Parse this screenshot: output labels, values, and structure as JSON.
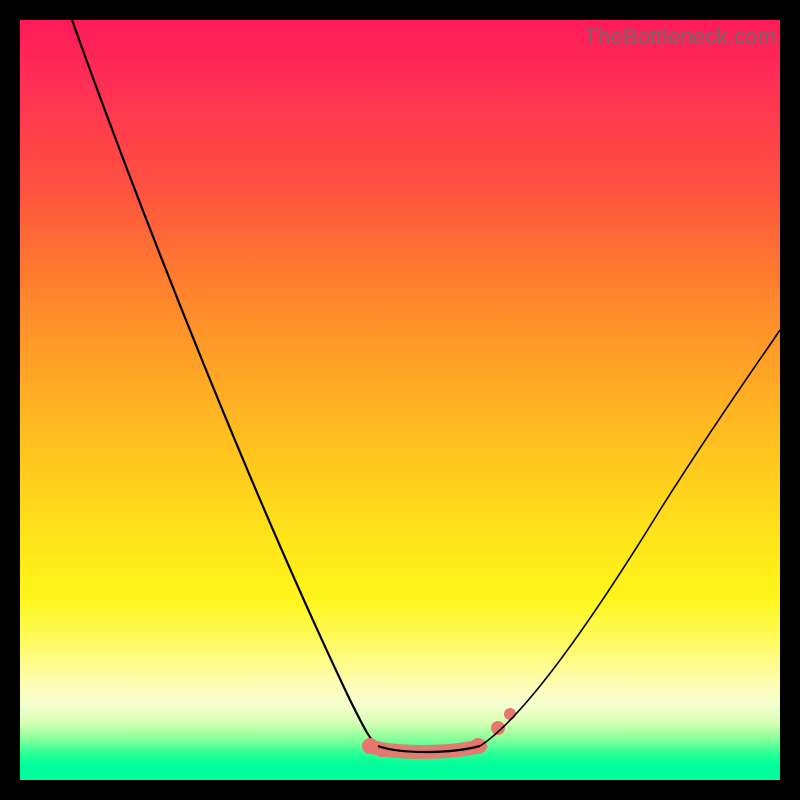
{
  "watermark": "TheBottleneck.com",
  "chart_data": {
    "type": "line",
    "title": "",
    "xlabel": "",
    "ylabel": "",
    "xlim": [
      0,
      100
    ],
    "ylim": [
      0,
      100
    ],
    "grid": false,
    "legend": false,
    "series": [
      {
        "name": "curve",
        "x": [
          7,
          15,
          25,
          33,
          40,
          45,
          50,
          58,
          62,
          70,
          80,
          90,
          100
        ],
        "y": [
          100,
          82,
          58,
          38,
          22,
          10,
          2,
          2,
          6,
          18,
          34,
          50,
          60
        ]
      }
    ],
    "annotations": [
      {
        "name": "optimal-band",
        "x_range": [
          44,
          62
        ],
        "y": 2
      }
    ],
    "gradient_stops": [
      {
        "pos": 0.0,
        "color": "#ff1a59"
      },
      {
        "pos": 0.33,
        "color": "#ff7a2f"
      },
      {
        "pos": 0.68,
        "color": "#ffe41a"
      },
      {
        "pos": 0.9,
        "color": "#f7ffd0"
      },
      {
        "pos": 0.97,
        "color": "#2bff94"
      },
      {
        "pos": 1.0,
        "color": "#00ff9c"
      }
    ]
  }
}
